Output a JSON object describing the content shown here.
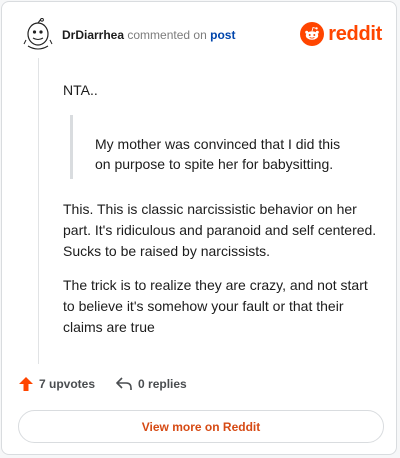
{
  "header": {
    "author": "DrDiarrhea",
    "action_text": "commented on",
    "post_link": "post",
    "brand": "reddit"
  },
  "comment": {
    "paragraph1": "NTA..",
    "quote_line1": "My mother was convinced that I did this",
    "quote_line2": "on purpose to spite her for babysitting.",
    "paragraph2": "This. This is classic narcissistic behavior on her part. It's ridiculous and paranoid and self centered. Sucks to be raised by narcissists.",
    "paragraph3": "The trick is to realize they are crazy, and not start to believe it's somehow your fault or that their claims are true"
  },
  "actions": {
    "upvotes": "7 upvotes",
    "replies": "0 replies"
  },
  "view_more": "View more on Reddit",
  "colors": {
    "accent": "#ff4500",
    "link": "#0045ac"
  }
}
